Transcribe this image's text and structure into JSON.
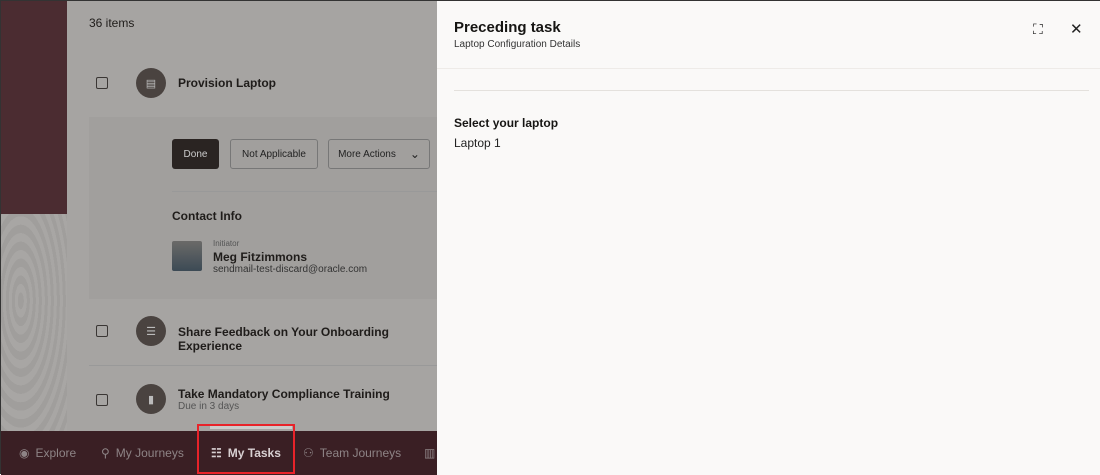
{
  "list": {
    "count": "36 items",
    "tasks": [
      {
        "title": "Provision Laptop",
        "icon": "chat-icon"
      },
      {
        "title": "Share Feedback on Your Onboarding Experience",
        "icon": "checklist-icon"
      },
      {
        "title": "Take Mandatory Compliance Training",
        "subtitle": "Due in 3 days",
        "icon": "document-icon"
      }
    ]
  },
  "actions": {
    "done": "Done",
    "not_applicable": "Not Applicable",
    "more": "More Actions"
  },
  "contact": {
    "heading": "Contact Info",
    "role": "Initiator",
    "name": "Meg Fitzimmons",
    "email": "sendmail-test-discard@oracle.com"
  },
  "nav": {
    "items": [
      "Explore",
      "My Journeys",
      "My Tasks",
      "Team Journeys"
    ],
    "active": "My Tasks"
  },
  "panel": {
    "title": "Preceding task",
    "subtitle": "Laptop Configuration Details",
    "field_label": "Select your laptop",
    "field_value": "Laptop 1"
  },
  "colors": {
    "highlight": "#e8232a",
    "nav_bg": "#3a1f24"
  }
}
